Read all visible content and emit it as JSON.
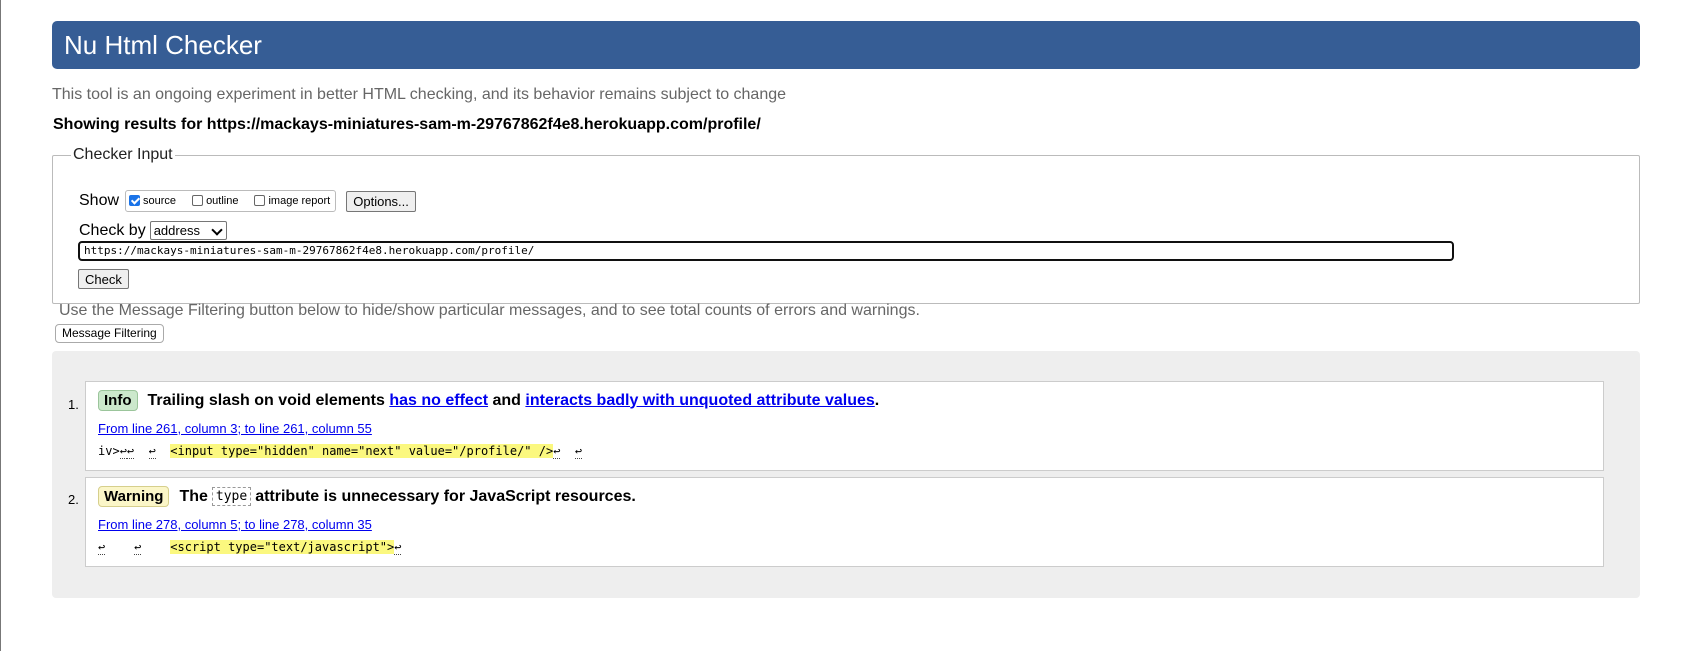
{
  "header": {
    "title": "Nu Html Checker"
  },
  "disclaimer": "This tool is an ongoing experiment in better HTML checking, and its behavior remains subject to change",
  "showing": "Showing results for https://mackays-miniatures-sam-m-29767862f4e8.herokuapp.com/profile/",
  "checker": {
    "legend": "Checker Input",
    "show_label": "Show",
    "options": [
      {
        "label": "source",
        "checked": true
      },
      {
        "label": "outline",
        "checked": false
      },
      {
        "label": "image report",
        "checked": false
      }
    ],
    "options_button": "Options...",
    "check_by_label": "Check by",
    "check_by_value": "address",
    "url_value": "https://mackays-miniatures-sam-m-29767862f4e8.herokuapp.com/profile/",
    "check_button": "Check"
  },
  "filter_note": "Use the Message Filtering button below to hide/show particular messages, and to see total counts of errors and warnings.",
  "filter_button": "Message Filtering",
  "messages": [
    {
      "num": "1.",
      "badge": "Info",
      "title_pre": "Trailing slash on void elements",
      "link1": "has no effect",
      "mid": "and",
      "link2": "interacts badly with unquoted attribute values",
      "post": ".",
      "location": "From line 261, column 3; to line 261, column 55",
      "excerpt_pre": "iv>",
      "excerpt_highlight": "<input type=\"hidden\" name=\"next\" value=\"/profile/\" />",
      "return_symbol": "↩"
    },
    {
      "num": "2.",
      "badge": "Warning",
      "title_pre": "The",
      "code": "type",
      "title_post": "attribute is unnecessary for JavaScript resources.",
      "location": "From line 278, column 5; to line 278, column 35",
      "excerpt_highlight": "<script type=\"text/javascript\">",
      "return_symbol": "↩"
    }
  ],
  "colors": {
    "header_bg": "#365d95",
    "info_badge": "#cce8cc",
    "warning_badge": "#fbf6c8",
    "highlight": "#fbf87f",
    "link": "#0000ee"
  }
}
